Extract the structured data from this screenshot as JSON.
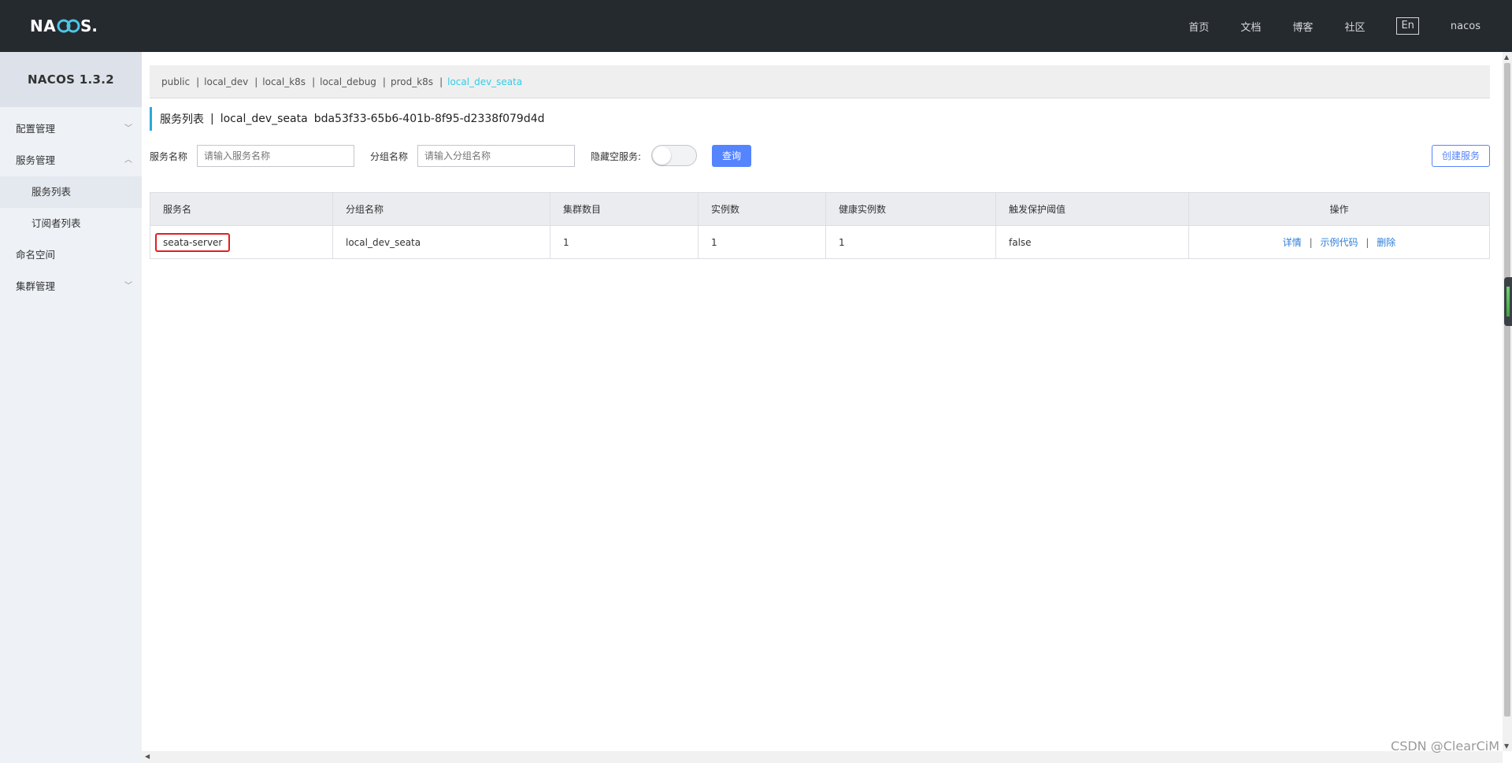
{
  "header": {
    "logo_text": "NACOS.",
    "nav": [
      "首页",
      "文档",
      "博客",
      "社区"
    ],
    "lang": "En",
    "user": "nacos"
  },
  "sidebar": {
    "title": "NACOS 1.3.2",
    "items": [
      {
        "label": "配置管理",
        "arrow": "﹀"
      },
      {
        "label": "服务管理",
        "arrow": "︿"
      },
      {
        "label": "服务列表"
      },
      {
        "label": "订阅者列表"
      },
      {
        "label": "命名空间"
      },
      {
        "label": "集群管理",
        "arrow": "﹀"
      }
    ]
  },
  "namespaces": {
    "items": [
      "public",
      "local_dev",
      "local_k8s",
      "local_debug",
      "prod_k8s",
      "local_dev_seata"
    ],
    "separator": "|",
    "active": "local_dev_seata"
  },
  "page": {
    "title": "服务列表",
    "separator": "|",
    "namespace_name": "local_dev_seata",
    "namespace_id": "bda53f33-65b6-401b-8f95-d2338f079d4d"
  },
  "search": {
    "service_name_label": "服务名称",
    "service_name_placeholder": "请输入服务名称",
    "group_name_label": "分组名称",
    "group_name_placeholder": "请输入分组名称",
    "hide_empty_label": "隐藏空服务:",
    "hide_empty_on": false,
    "query_button": "查询",
    "create_button": "创建服务"
  },
  "table": {
    "headers": [
      "服务名",
      "分组名称",
      "集群数目",
      "实例数",
      "健康实例数",
      "触发保护阈值",
      "操作"
    ],
    "rows": [
      {
        "service": "seata-server",
        "group": "local_dev_seata",
        "clusters": "1",
        "instances": "1",
        "healthy": "1",
        "protect": "false",
        "actions": [
          "详情",
          "示例代码",
          "删除"
        ]
      }
    ]
  },
  "watermark": "CSDN @ClearCiM",
  "colors": {
    "header_bg": "#252a2f",
    "accent": "#5584ff",
    "active_namespace": "#33cde5",
    "link": "#2d7fd9",
    "highlight_box": "#e02020"
  }
}
